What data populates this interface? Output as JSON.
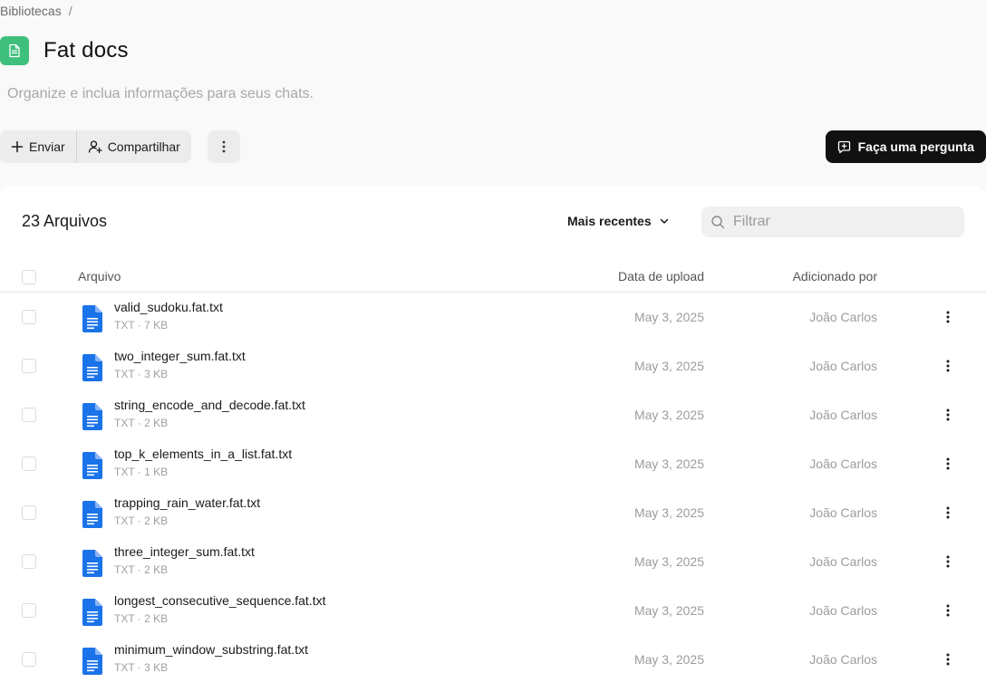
{
  "breadcrumb": {
    "root": "Bibliotecas",
    "separator": "/"
  },
  "library": {
    "title": "Fat docs",
    "description": "Organize e inclua informações para seus chats.",
    "icon": "document-icon",
    "icon_color": "#3fbf7c"
  },
  "toolbar": {
    "upload_label": "Enviar",
    "share_label": "Compartilhar",
    "ask_label": "Faça uma pergunta"
  },
  "files_panel": {
    "count_label": "23 Arquivos",
    "sort_label": "Mais recentes",
    "filter_placeholder": "Filtrar",
    "columns": {
      "file": "Arquivo",
      "date": "Data de upload",
      "added_by": "Adicionado por"
    }
  },
  "files": [
    {
      "name": "valid_sudoku.fat.txt",
      "meta": "TXT · 7 KB",
      "date": "May 3, 2025",
      "user": "João Carlos"
    },
    {
      "name": "two_integer_sum.fat.txt",
      "meta": "TXT · 3 KB",
      "date": "May 3, 2025",
      "user": "João Carlos"
    },
    {
      "name": "string_encode_and_decode.fat.txt",
      "meta": "TXT · 2 KB",
      "date": "May 3, 2025",
      "user": "João Carlos"
    },
    {
      "name": "top_k_elements_in_a_list.fat.txt",
      "meta": "TXT · 1 KB",
      "date": "May 3, 2025",
      "user": "João Carlos"
    },
    {
      "name": "trapping_rain_water.fat.txt",
      "meta": "TXT · 2 KB",
      "date": "May 3, 2025",
      "user": "João Carlos"
    },
    {
      "name": "three_integer_sum.fat.txt",
      "meta": "TXT · 2 KB",
      "date": "May 3, 2025",
      "user": "João Carlos"
    },
    {
      "name": "longest_consecutive_sequence.fat.txt",
      "meta": "TXT · 2 KB",
      "date": "May 3, 2025",
      "user": "João Carlos"
    },
    {
      "name": "minimum_window_substring.fat.txt",
      "meta": "TXT · 3 KB",
      "date": "May 3, 2025",
      "user": "João Carlos"
    }
  ],
  "colors": {
    "file_icon": "#1a73e8",
    "ask_button_bg": "#111111"
  }
}
